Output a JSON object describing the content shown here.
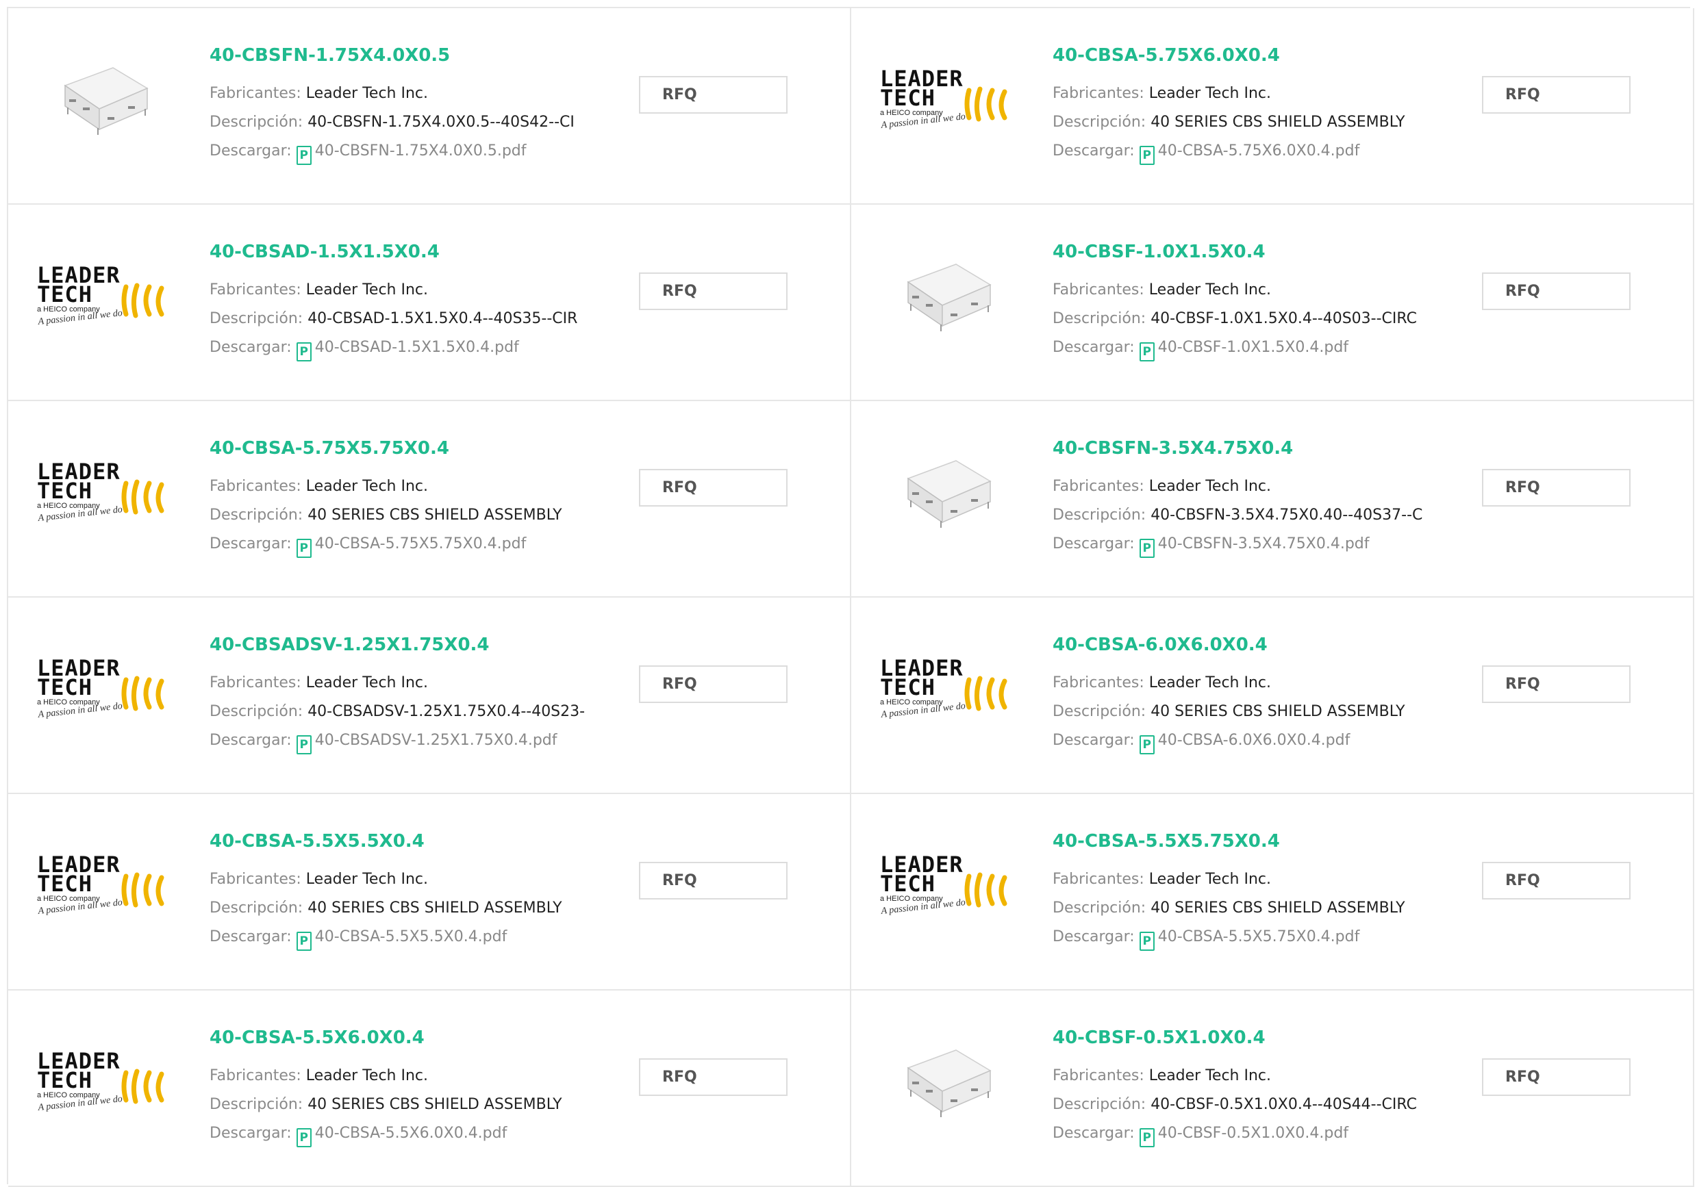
{
  "labels": {
    "manufacturer": "Fabricantes:",
    "description": "Descripción:",
    "download": "Descargar:",
    "rfq": "RFQ",
    "pdf_glyph": "P"
  },
  "logo_text": {
    "line1": "LEADER",
    "line2": "TECH",
    "line3": "a HEICO company",
    "line4": "A passion in all we do"
  },
  "colors": {
    "accent": "#1fba8e",
    "logo_yellow": "#f0b400"
  },
  "products": [
    {
      "name": "40-CBSFN-1.75X4.0X0.5",
      "image": "chip-image",
      "manufacturer": "Leader Tech Inc.",
      "description": "40-CBSFN-1.75X4.0X0.5--40S42--CI",
      "file": "40-CBSFN-1.75X4.0X0.5.pdf"
    },
    {
      "name": "40-CBSA-5.75X6.0X0.4",
      "image": "logo-image",
      "manufacturer": "Leader Tech Inc.",
      "description": "40 SERIES CBS SHIELD ASSEMBLY",
      "file": "40-CBSA-5.75X6.0X0.4.pdf"
    },
    {
      "name": "40-CBSAD-1.5X1.5X0.4",
      "image": "logo-image",
      "manufacturer": "Leader Tech Inc.",
      "description": "40-CBSAD-1.5X1.5X0.4--40S35--CIR",
      "file": "40-CBSAD-1.5X1.5X0.4.pdf"
    },
    {
      "name": "40-CBSF-1.0X1.5X0.4",
      "image": "chip-image",
      "manufacturer": "Leader Tech Inc.",
      "description": "40-CBSF-1.0X1.5X0.4--40S03--CIRC",
      "file": "40-CBSF-1.0X1.5X0.4.pdf"
    },
    {
      "name": "40-CBSA-5.75X5.75X0.4",
      "image": "logo-image",
      "manufacturer": "Leader Tech Inc.",
      "description": "40 SERIES CBS SHIELD ASSEMBLY",
      "file": "40-CBSA-5.75X5.75X0.4.pdf"
    },
    {
      "name": "40-CBSFN-3.5X4.75X0.4",
      "image": "chip-image",
      "manufacturer": "Leader Tech Inc.",
      "description": "40-CBSFN-3.5X4.75X0.40--40S37--C",
      "file": "40-CBSFN-3.5X4.75X0.4.pdf"
    },
    {
      "name": "40-CBSADSV-1.25X1.75X0.4",
      "image": "logo-image",
      "manufacturer": "Leader Tech Inc.",
      "description": "40-CBSADSV-1.25X1.75X0.4--40S23-",
      "file": "40-CBSADSV-1.25X1.75X0.4.pdf"
    },
    {
      "name": "40-CBSA-6.0X6.0X0.4",
      "image": "logo-image",
      "manufacturer": "Leader Tech Inc.",
      "description": "40 SERIES CBS SHIELD ASSEMBLY",
      "file": "40-CBSA-6.0X6.0X0.4.pdf"
    },
    {
      "name": "40-CBSA-5.5X5.5X0.4",
      "image": "logo-image",
      "manufacturer": "Leader Tech Inc.",
      "description": "40 SERIES CBS SHIELD ASSEMBLY",
      "file": "40-CBSA-5.5X5.5X0.4.pdf"
    },
    {
      "name": "40-CBSA-5.5X5.75X0.4",
      "image": "logo-image",
      "manufacturer": "Leader Tech Inc.",
      "description": "40 SERIES CBS SHIELD ASSEMBLY",
      "file": "40-CBSA-5.5X5.75X0.4.pdf"
    },
    {
      "name": "40-CBSA-5.5X6.0X0.4",
      "image": "logo-image",
      "manufacturer": "Leader Tech Inc.",
      "description": "40 SERIES CBS SHIELD ASSEMBLY",
      "file": "40-CBSA-5.5X6.0X0.4.pdf"
    },
    {
      "name": "40-CBSF-0.5X1.0X0.4",
      "image": "chip-image",
      "manufacturer": "Leader Tech Inc.",
      "description": "40-CBSF-0.5X1.0X0.4--40S44--CIRC",
      "file": "40-CBSF-0.5X1.0X0.4.pdf"
    }
  ]
}
